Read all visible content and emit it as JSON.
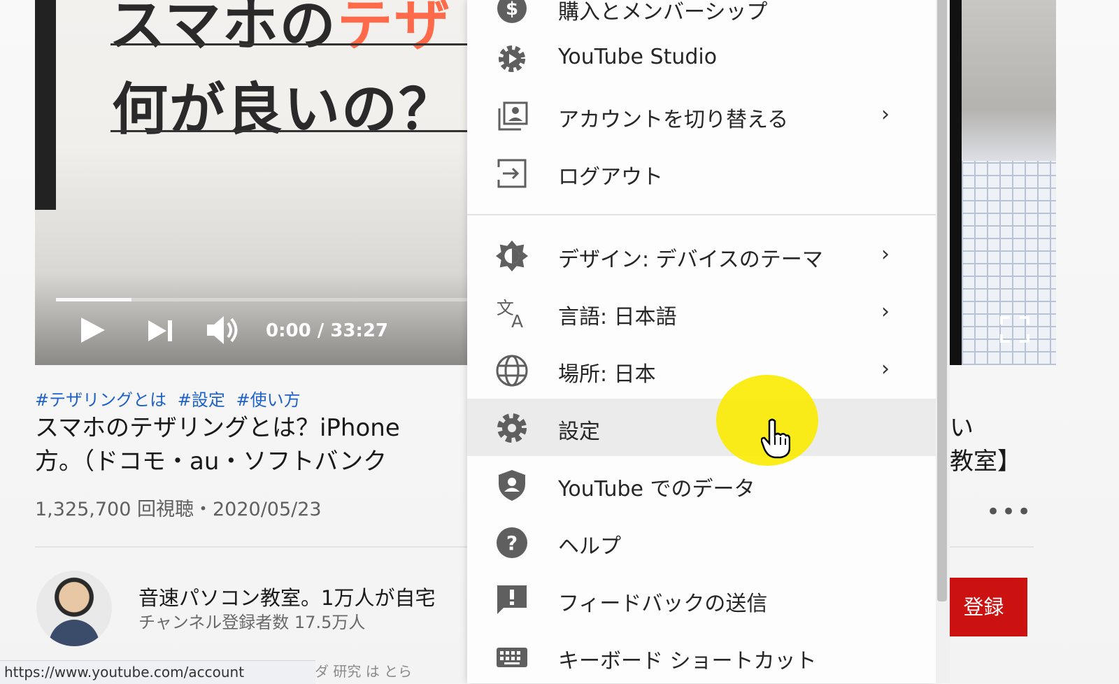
{
  "video": {
    "thumbnail_line1_a": "スマホの",
    "thumbnail_line1_b": "テザ",
    "thumbnail_line2": "何が良いの？",
    "time": "0:00 / 33:27",
    "progress": 0.0
  },
  "tags": [
    "#テザリングとは",
    "#設定",
    "#使い方"
  ],
  "title": {
    "line1": "スマホのテザリングとは？iPhone",
    "line2": "方。（ドコモ・au・ソフトバンク",
    "line1_right": "い",
    "line2_right": "教室】"
  },
  "meta": "1,325,700 回視聴・2020/05/23",
  "more_label": "•••",
  "channel": {
    "name": "音速パソコン教室。1万人が自宅",
    "subscribers": "チャンネル登録者数 17.5万人",
    "subscribe_label": "登録"
  },
  "statusbar": {
    "url": "https://www.youtube.com/account",
    "right": "ダ 研究 は とら"
  },
  "menu": {
    "items": [
      {
        "label": "購入とメンバーシップ",
        "icon": "dollar-icon",
        "chevron": false
      },
      {
        "label": "YouTube Studio",
        "icon": "gear-studio-icon",
        "chevron": false
      },
      {
        "label": "アカウントを切り替える",
        "icon": "switch-account-icon",
        "chevron": true
      },
      {
        "label": "ログアウト",
        "icon": "logout-icon",
        "chevron": false
      },
      {
        "label": "デザイン: デバイスのテーマ",
        "icon": "theme-icon",
        "chevron": true
      },
      {
        "label": "言語: 日本語",
        "icon": "translate-icon",
        "chevron": true
      },
      {
        "label": "場所: 日本",
        "icon": "globe-icon",
        "chevron": true
      },
      {
        "label": "設定",
        "icon": "gear-icon",
        "chevron": false
      },
      {
        "label": "YouTube でのデータ",
        "icon": "shield-person-icon",
        "chevron": false
      },
      {
        "label": "ヘルプ",
        "icon": "help-icon",
        "chevron": false
      },
      {
        "label": "フィードバックの送信",
        "icon": "feedback-icon",
        "chevron": false
      },
      {
        "label": "キーボード ショートカット",
        "icon": "keyboard-icon",
        "chevron": false
      }
    ],
    "chevron_glyph": "›"
  },
  "colors": {
    "accent_red": "#cc1111",
    "tag_blue": "#1e62c8",
    "cursor_highlight": "#faeb00"
  }
}
